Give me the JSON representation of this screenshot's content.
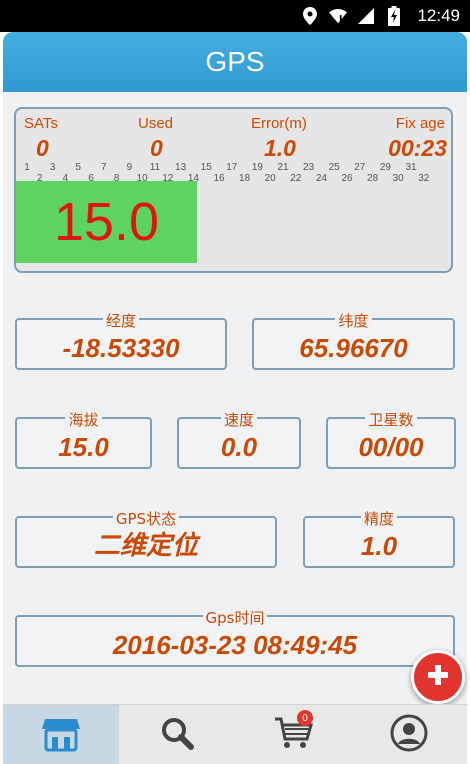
{
  "status_bar": {
    "time": "12:49",
    "icons": [
      "location-icon",
      "wifi-icon",
      "signal-icon",
      "battery-charging-icon"
    ]
  },
  "header": {
    "title": "GPS"
  },
  "satellite_panel": {
    "sats_label": "SATs",
    "sats_value": "0",
    "used_label": "Used",
    "used_value": "0",
    "error_label": "Error(m)",
    "error_value": "1.0",
    "fixage_label": "Fix age",
    "fixage_value": "00:23",
    "ticks_odd": [
      "1",
      "3",
      "5",
      "7",
      "9",
      "11",
      "13",
      "15",
      "17",
      "19",
      "21",
      "23",
      "25",
      "27",
      "29",
      "31"
    ],
    "ticks_even": [
      "2",
      "4",
      "6",
      "8",
      "10",
      "12",
      "14",
      "16",
      "18",
      "20",
      "22",
      "24",
      "26",
      "28",
      "30",
      "32"
    ],
    "altitude_display": "15.0",
    "altitude_bg_color": "#5fd35f",
    "altitude_text_color": "#e01515"
  },
  "info": {
    "longitude_label": "经度",
    "longitude_value": "-18.53330",
    "latitude_label": "纬度",
    "latitude_value": "65.96670",
    "altitude_label": "海拔",
    "altitude_value": "15.0",
    "speed_label": "速度",
    "speed_value": "0.0",
    "satellites_label": "卫星数",
    "satellites_value": "00/00",
    "gps_status_label": "GPS状态",
    "gps_status_value": "二维定位",
    "accuracy_label": "精度",
    "accuracy_value": "1.0",
    "gps_time_label": "Gps时间",
    "gps_time_value": "2016-03-23 08:49:45"
  },
  "fab": {
    "icon": "plus-icon"
  },
  "bottom_nav": {
    "items": [
      {
        "icon": "store-icon",
        "active": true
      },
      {
        "icon": "search-icon",
        "active": false
      },
      {
        "icon": "cart-icon",
        "badge": "0",
        "active": false
      },
      {
        "icon": "user-icon",
        "active": false
      }
    ]
  },
  "colors": {
    "accent_blue": "#2f9ad3",
    "label_orange": "#c94a06",
    "border_blue": "#7e9fb8",
    "fab_red": "#e23530"
  }
}
